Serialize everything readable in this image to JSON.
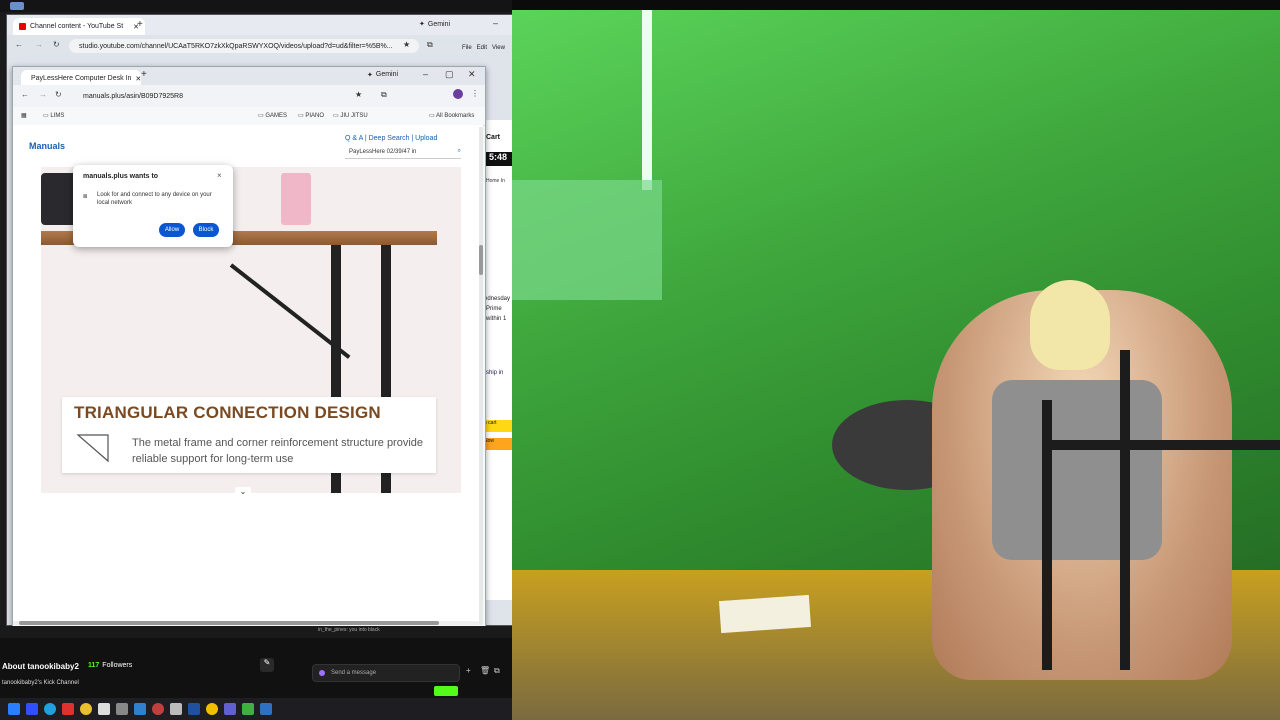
{
  "outer_browser": {
    "tab_title": "Channel content - YouTube St",
    "new_tab": "+",
    "gemini_label": "Gemini",
    "url": "studio.youtube.com/channel/UCAaT5RKO7zkXkQpaRSWYXOQ/videos/upload?d=ud&filter=%5B%..."
  },
  "inner_browser": {
    "tab_title": "PayLessHere Computer Desk In",
    "new_tab": "+",
    "gemini_label": "Gemini",
    "url": "manuals.plus/asin/B09D7925R8",
    "bookmarks": [
      "LIMS",
      "GAMES",
      "PIANO",
      "JIU JITSU"
    ],
    "all_bookmarks": "All Bookmarks",
    "minimize": "–",
    "maximize": "▢",
    "close": "✕"
  },
  "page": {
    "site_name": "Manuals",
    "top_links": "Q & A | Deep Search | Upload",
    "search_text": "PayLessHere 02/39/47 in"
  },
  "permission_popup": {
    "title": "manuals.plus wants to",
    "description": "Look for and connect to any device on your local network",
    "allow": "Allow",
    "block": "Block",
    "close": "×"
  },
  "product_banner": {
    "title": "TRIANGULAR CONNECTION DESIGN",
    "description": "The metal frame and corner reinforcement structure provide reliable support for long-term use"
  },
  "side_peek": {
    "cart": "Cart",
    "clock": "5:48",
    "home": "Home In",
    "day": "ednesday",
    "prime": "Prime",
    "within": "within 1",
    "ship": "ship in",
    "add_cart": "o cart",
    "now": "Now"
  },
  "kick": {
    "about": "About tanookibaby2",
    "followers_count": "117",
    "followers_label": "Followers",
    "channel_label": "tanookibaby2's Kick Channel",
    "chat_placeholder": "Send a message",
    "chat_notice": "in_the_pines: you into black"
  },
  "menus": [
    "File",
    "Edit",
    "View"
  ],
  "colors": {
    "accent_blue": "#0b57d0",
    "banner_title": "#7a4a22",
    "kick_green": "#53fc18",
    "wall_green": "#3ea63c"
  }
}
